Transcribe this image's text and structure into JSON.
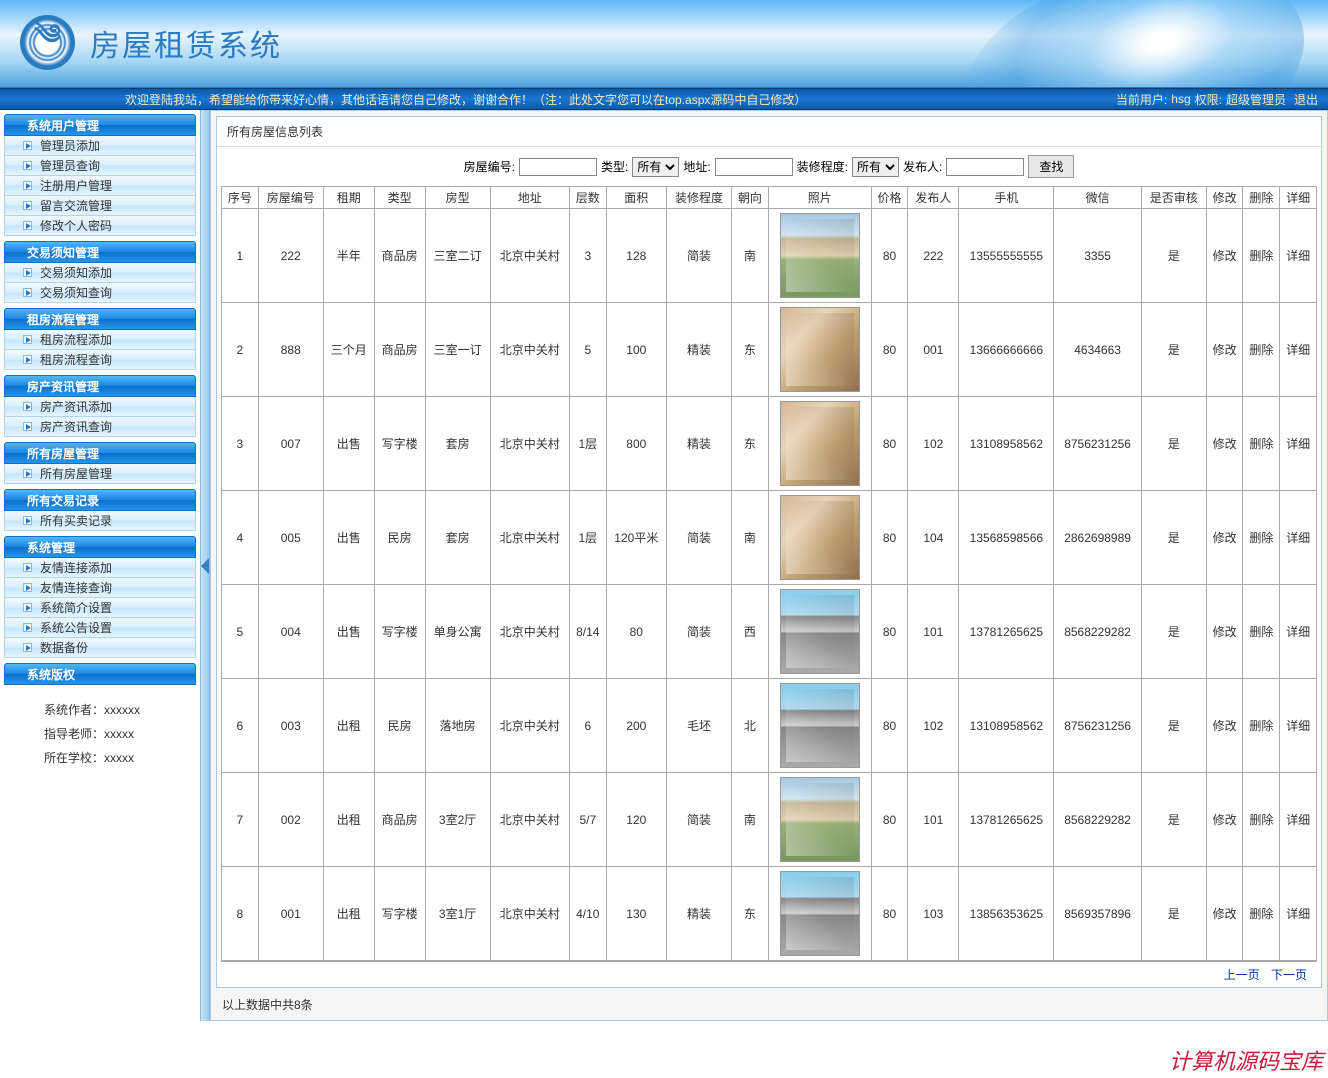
{
  "header": {
    "app_title": "房屋租赁系统"
  },
  "status": {
    "welcome": "欢迎登陆我站，希望能给你带来好心情，其他话语请您自己修改，谢谢合作！（注：此处文字您可以在top.aspx源码中自己修改）",
    "user_label": "当前用户:",
    "username": "hsg",
    "perm_label": "权限:",
    "permission": "超级管理员",
    "logout": "退出"
  },
  "sidebar": {
    "sections": [
      {
        "title": "系统用户管理",
        "items": [
          "管理员添加",
          "管理员查询",
          "注册用户管理",
          "留言交流管理",
          "修改个人密码"
        ]
      },
      {
        "title": "交易须知管理",
        "items": [
          "交易须知添加",
          "交易须知查询"
        ]
      },
      {
        "title": "租房流程管理",
        "items": [
          "租房流程添加",
          "租房流程查询"
        ]
      },
      {
        "title": "房产资讯管理",
        "items": [
          "房产资讯添加",
          "房产资讯查询"
        ]
      },
      {
        "title": "所有房屋管理",
        "items": [
          "所有房屋管理"
        ]
      },
      {
        "title": "所有交易记录",
        "items": [
          "所有买卖记录"
        ]
      },
      {
        "title": "系统管理",
        "items": [
          "友情连接添加",
          "友情连接查询",
          "系统简介设置",
          "系统公告设置",
          "数据备份"
        ]
      },
      {
        "title": "系统版权",
        "items": []
      }
    ],
    "credits": {
      "author_label": "系统作者：",
      "author": "xxxxxx",
      "teacher_label": "指导老师：",
      "teacher": "xxxxx",
      "school_label": "所在学校：",
      "school": "xxxxx"
    }
  },
  "main": {
    "panel_title": "所有房屋信息列表",
    "filters": {
      "code_label": "房屋编号:",
      "type_label": "类型:",
      "type_value": "所有",
      "addr_label": "地址:",
      "deco_label": "装修程度:",
      "deco_value": "所有",
      "pub_label": "发布人:",
      "search_btn": "查找"
    },
    "columns": [
      "序号",
      "房屋编号",
      "租期",
      "类型",
      "房型",
      "地址",
      "层数",
      "面积",
      "装修程度",
      "朝向",
      "照片",
      "价格",
      "发布人",
      "手机",
      "微信",
      "是否审核",
      "修改",
      "删除",
      "详细"
    ],
    "rows": [
      {
        "idx": "1",
        "code": "222",
        "lease": "半年",
        "type": "商品房",
        "layout": "三室二订",
        "addr": "北京中关村",
        "floor": "3",
        "area": "128",
        "deco": "简装",
        "face": "南",
        "img": "house",
        "price": "80",
        "pub": "222",
        "phone": "13555555555",
        "wechat": "3355",
        "audit": "是"
      },
      {
        "idx": "2",
        "code": "888",
        "lease": "三个月",
        "type": "商品房",
        "layout": "三室一订",
        "addr": "北京中关村",
        "floor": "5",
        "area": "100",
        "deco": "精装",
        "face": "东",
        "img": "interior",
        "price": "80",
        "pub": "001",
        "phone": "13666666666",
        "wechat": "4634663",
        "audit": "是"
      },
      {
        "idx": "3",
        "code": "007",
        "lease": "出售",
        "type": "写字楼",
        "layout": "套房",
        "addr": "北京中关村",
        "floor": "1层",
        "area": "800",
        "deco": "精装",
        "face": "东",
        "img": "interior",
        "price": "80",
        "pub": "102",
        "phone": "13108958562",
        "wechat": "8756231256",
        "audit": "是"
      },
      {
        "idx": "4",
        "code": "005",
        "lease": "出售",
        "type": "民房",
        "layout": "套房",
        "addr": "北京中关村",
        "floor": "1层",
        "area": "120平米",
        "deco": "简装",
        "face": "南",
        "img": "interior",
        "price": "80",
        "pub": "104",
        "phone": "13568598566",
        "wechat": "2862698989",
        "audit": "是"
      },
      {
        "idx": "5",
        "code": "004",
        "lease": "出售",
        "type": "写字楼",
        "layout": "单身公寓",
        "addr": "北京中关村",
        "floor": "8/14",
        "area": "80",
        "deco": "简装",
        "face": "西",
        "img": "building",
        "price": "80",
        "pub": "101",
        "phone": "13781265625",
        "wechat": "8568229282",
        "audit": "是"
      },
      {
        "idx": "6",
        "code": "003",
        "lease": "出租",
        "type": "民房",
        "layout": "落地房",
        "addr": "北京中关村",
        "floor": "6",
        "area": "200",
        "deco": "毛坯",
        "face": "北",
        "img": "building",
        "price": "80",
        "pub": "102",
        "phone": "13108958562",
        "wechat": "8756231256",
        "audit": "是"
      },
      {
        "idx": "7",
        "code": "002",
        "lease": "出租",
        "type": "商品房",
        "layout": "3室2厅",
        "addr": "北京中关村",
        "floor": "5/7",
        "area": "120",
        "deco": "简装",
        "face": "南",
        "img": "house",
        "price": "80",
        "pub": "101",
        "phone": "13781265625",
        "wechat": "8568229282",
        "audit": "是"
      },
      {
        "idx": "8",
        "code": "001",
        "lease": "出租",
        "type": "写字楼",
        "layout": "3室1厅",
        "addr": "北京中关村",
        "floor": "4/10",
        "area": "130",
        "deco": "精装",
        "face": "东",
        "img": "building",
        "price": "80",
        "pub": "103",
        "phone": "13856353625",
        "wechat": "8569357896",
        "audit": "是"
      }
    ],
    "actions": {
      "edit": "修改",
      "del": "删除",
      "detail": "详细"
    },
    "pager": {
      "prev": "上一页",
      "next": "下一页"
    },
    "footer": "以上数据中共8条"
  },
  "watermark": "计算机源码宝库"
}
